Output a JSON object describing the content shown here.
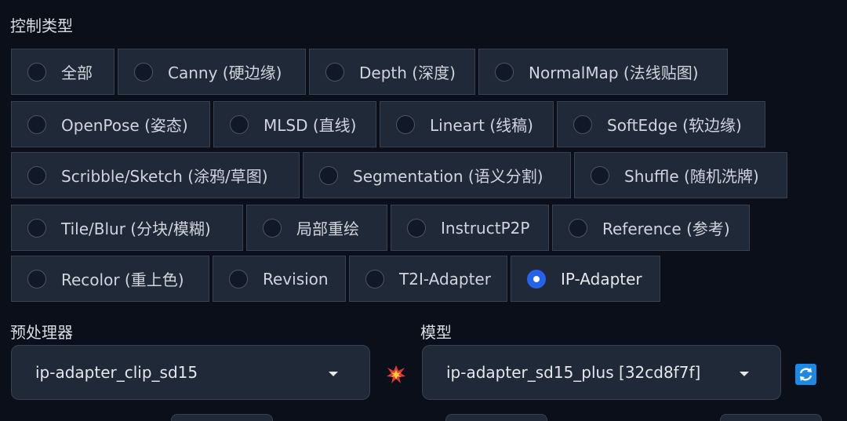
{
  "control_type_label": "控制类型",
  "control_types": [
    [
      {
        "label": "全部",
        "checked": false
      },
      {
        "label": "Canny (硬边缘)",
        "checked": false
      },
      {
        "label": "Depth (深度)",
        "checked": false
      },
      {
        "label": "NormalMap (法线贴图)",
        "checked": false
      }
    ],
    [
      {
        "label": "OpenPose (姿态)",
        "checked": false
      },
      {
        "label": "MLSD (直线)",
        "checked": false
      },
      {
        "label": "Lineart (线稿)",
        "checked": false
      },
      {
        "label": "SoftEdge (软边缘)",
        "checked": false
      }
    ],
    [
      {
        "label": "Scribble/Sketch (涂鸦/草图)",
        "checked": false
      },
      {
        "label": "Segmentation (语义分割)",
        "checked": false
      },
      {
        "label": "Shuffle (随机洗牌)",
        "checked": false
      }
    ],
    [
      {
        "label": "Tile/Blur (分块/模糊)",
        "checked": false
      },
      {
        "label": "局部重绘",
        "checked": false
      },
      {
        "label": "InstructP2P",
        "checked": false
      },
      {
        "label": "Reference (参考)",
        "checked": false
      }
    ],
    [
      {
        "label": "Recolor (重上色)",
        "checked": false
      },
      {
        "label": "Revision",
        "checked": false
      },
      {
        "label": "T2I-Adapter",
        "checked": false
      },
      {
        "label": "IP-Adapter",
        "checked": true
      }
    ]
  ],
  "preprocessor": {
    "label": "预处理器",
    "value": "ip-adapter_clip_sd15"
  },
  "model": {
    "label": "模型",
    "value": "ip-adapter_sd15_plus [32cd8f7f]"
  },
  "icons": {
    "run_preprocessor": "explosion-icon",
    "refresh_models": "refresh-icon"
  },
  "colors": {
    "background": "#0b0f19",
    "option_background": "#1f2937",
    "accent": "#2563eb"
  }
}
